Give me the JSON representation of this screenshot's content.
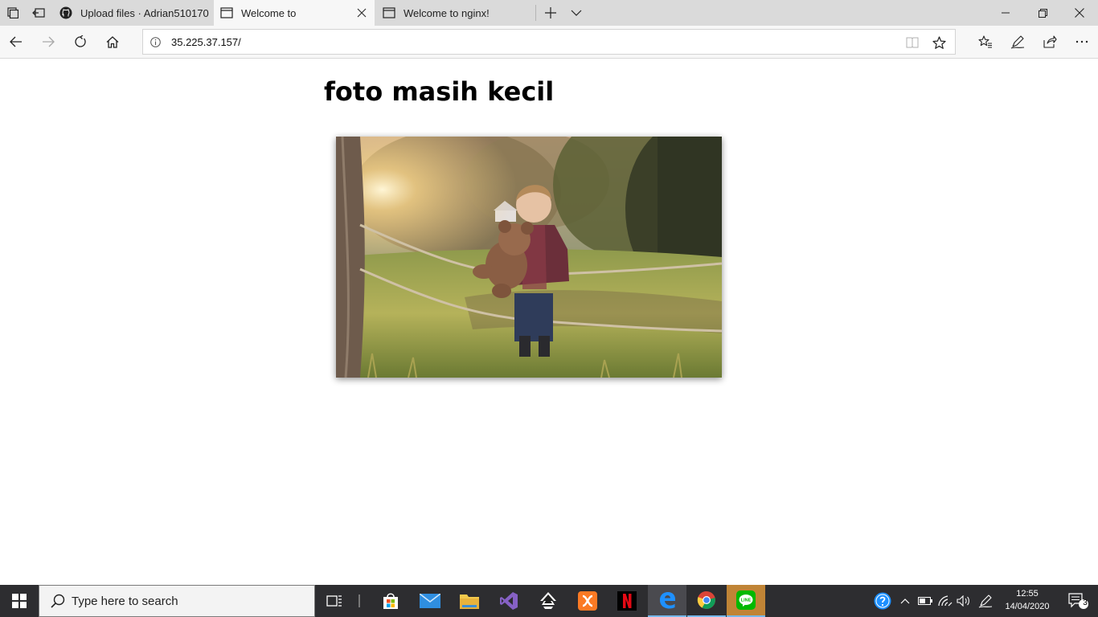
{
  "browser": {
    "tabs": [
      {
        "title": "Upload files · Adrian510170",
        "icon": "github-icon",
        "active": false
      },
      {
        "title": "Welcome to",
        "icon": "page-icon",
        "active": true
      },
      {
        "title": "Welcome to nginx!",
        "icon": "page-icon",
        "active": false
      }
    ],
    "address_url": "35.225.37.157/"
  },
  "page": {
    "heading": "foto masih kecil",
    "photo_alt": "child with teddy bear"
  },
  "taskbar": {
    "search_placeholder": "Type here to search",
    "apps": [
      "task-view-icon",
      "store-icon",
      "mail-icon",
      "file-explorer-icon",
      "visual-studio-icon",
      "inkscape-icon",
      "xampp-icon",
      "netflix-icon",
      "edge-icon",
      "chrome-icon",
      "line-icon"
    ],
    "clock_time": "12:55",
    "clock_date": "14/04/2020",
    "notification_count": "3"
  },
  "colors": {
    "taskbar_bg": "#2d2d30",
    "tab_bar_bg": "#dadada",
    "accent": "#76b9ed",
    "line_green": "#00b900",
    "netflix_red": "#e50914"
  }
}
